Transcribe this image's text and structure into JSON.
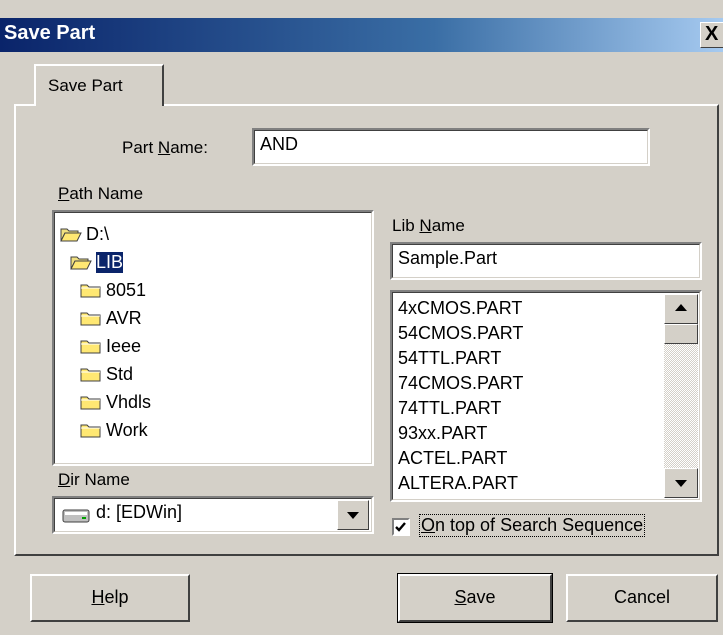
{
  "window": {
    "title": "Save Part",
    "close_glyph": "X"
  },
  "tab": {
    "label": "Save Part"
  },
  "part_name": {
    "label_pre": "Part ",
    "label_u": "N",
    "label_post": "ame:",
    "value": "AND"
  },
  "path_name": {
    "label_u": "P",
    "label_post": "ath Name",
    "items": [
      {
        "label": "D:\\",
        "icon": "open-folder-icon",
        "selected": false
      },
      {
        "label": "LIB",
        "icon": "open-folder-icon",
        "selected": true
      },
      {
        "label": "8051",
        "icon": "folder-icon",
        "selected": false
      },
      {
        "label": "AVR",
        "icon": "folder-icon",
        "selected": false
      },
      {
        "label": "Ieee",
        "icon": "folder-icon",
        "selected": false
      },
      {
        "label": "Std",
        "icon": "folder-icon",
        "selected": false
      },
      {
        "label": "Vhdls",
        "icon": "folder-icon",
        "selected": false
      },
      {
        "label": "Work",
        "icon": "folder-icon",
        "selected": false
      }
    ]
  },
  "dir_name": {
    "label_u": "D",
    "label_post": "ir Name",
    "value": "d: [EDWin]",
    "icon": "drive-icon"
  },
  "lib_name": {
    "label_pre": "Lib ",
    "label_u": "N",
    "label_post": "ame",
    "value": "Sample.Part",
    "items": [
      "4xCMOS.PART",
      "54CMOS.PART",
      "54TTL.PART",
      "74CMOS.PART",
      "74TTL.PART",
      "93xx.PART",
      "ACTEL.PART",
      "ALTERA.PART"
    ]
  },
  "search_sequence": {
    "label_u": "O",
    "label_post": "n top of Search Sequence",
    "checked": true
  },
  "buttons": {
    "help_u": "H",
    "help_post": "elp",
    "save_u": "S",
    "save_post": "ave",
    "cancel": "Cancel"
  },
  "colors": {
    "face": "#d4d0c8",
    "title_start": "#0a246a",
    "selection": "#0a246a"
  }
}
